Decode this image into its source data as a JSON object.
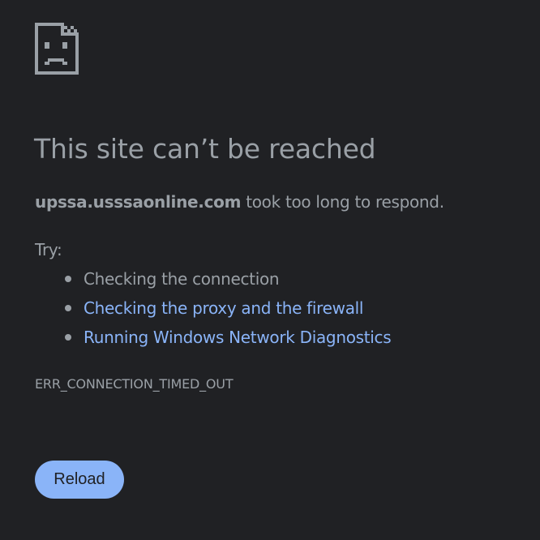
{
  "icon": {
    "name": "sad-page-icon",
    "color": "#9aa0a6"
  },
  "title": "This site can’t be reached",
  "description": {
    "host": "upssa.usssaonline.com",
    "message": " took too long to respond."
  },
  "try_label": "Try:",
  "suggestions": [
    {
      "label": "Checking the connection",
      "is_link": false
    },
    {
      "label": "Checking the proxy and the firewall",
      "is_link": true
    },
    {
      "label": "Running Windows Network Diagnostics",
      "is_link": true
    }
  ],
  "error_code": "ERR_CONNECTION_TIMED_OUT",
  "reload_label": "Reload",
  "colors": {
    "background": "#202124",
    "text": "#9aa0a6",
    "link": "#8ab4f8",
    "button_bg": "#8ab4f8",
    "button_text": "#202124"
  }
}
